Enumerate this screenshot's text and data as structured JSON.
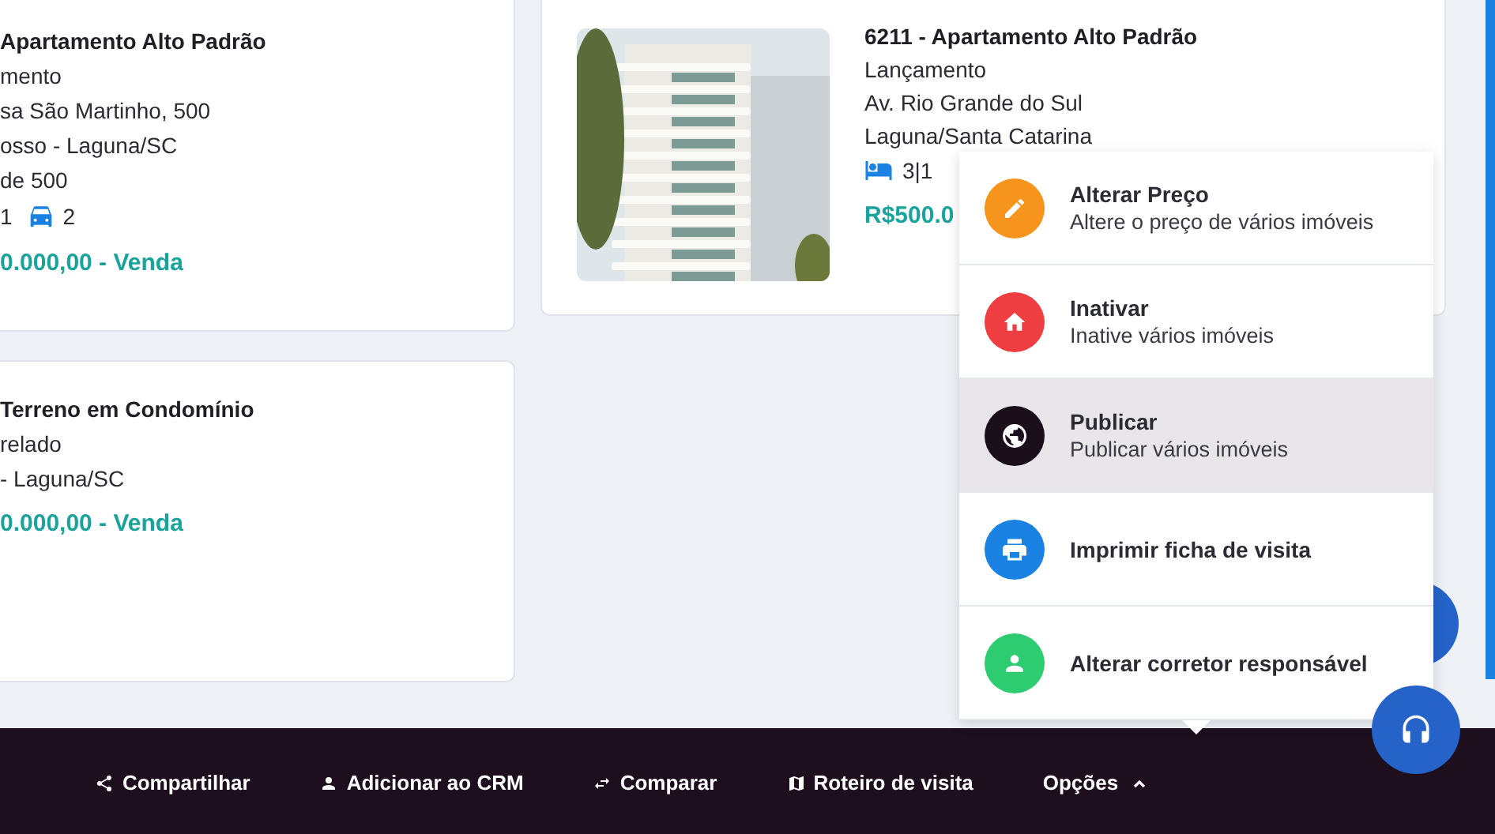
{
  "cards": [
    {
      "title": "Apartamento Alto Padrão",
      "lines": [
        "mento",
        "sa São Martinho, 500",
        "osso - Laguna/SC",
        "de 500"
      ],
      "features": [
        {
          "kind": "text",
          "value": "1"
        },
        {
          "kind": "car",
          "value": "2"
        }
      ],
      "price": "0.000,00 - Venda"
    },
    {
      "title": "Terreno em Condomínio",
      "lines": [
        "relado",
        "- Laguna/SC"
      ],
      "price": "0.000,00 - Venda"
    }
  ],
  "featured": {
    "image": {
      "kind": "picture"
    },
    "title": "6211 - Apartamento Alto Padrão",
    "lines": [
      "Lançamento",
      "Av. Rio Grande do Sul",
      "Laguna/Santa Catarina"
    ],
    "features": [
      {
        "kind": "bed",
        "value": "3|1"
      }
    ],
    "price": "R$500.0"
  },
  "menu": [
    {
      "kind": "pencil",
      "color": "#f7941d",
      "title": "Alterar Preço",
      "subtitle": "Altere o preço de vários imóveis",
      "selected": false
    },
    {
      "kind": "home",
      "color": "#ef3e42",
      "title": "Inativar",
      "subtitle": "Inative vários imóveis",
      "selected": false
    },
    {
      "kind": "globe",
      "color": "#1c0f1c",
      "title": "Publicar",
      "subtitle": "Publicar vários imóveis",
      "selected": true
    },
    {
      "kind": "printer",
      "color": "#1a82e2",
      "title": "Imprimir ficha de visita",
      "selected": false
    },
    {
      "kind": "person",
      "color": "#2ecc71",
      "title": "Alterar corretor responsável",
      "selected": false
    }
  ],
  "actions": [
    {
      "kind": "share",
      "label": "Compartilhar"
    },
    {
      "kind": "person",
      "label": "Adicionar ao CRM"
    },
    {
      "kind": "swap",
      "label": "Comparar"
    },
    {
      "kind": "map",
      "label": "Roteiro de visita"
    },
    {
      "kind": "caret",
      "label": "Opções",
      "expanded": true
    }
  ]
}
